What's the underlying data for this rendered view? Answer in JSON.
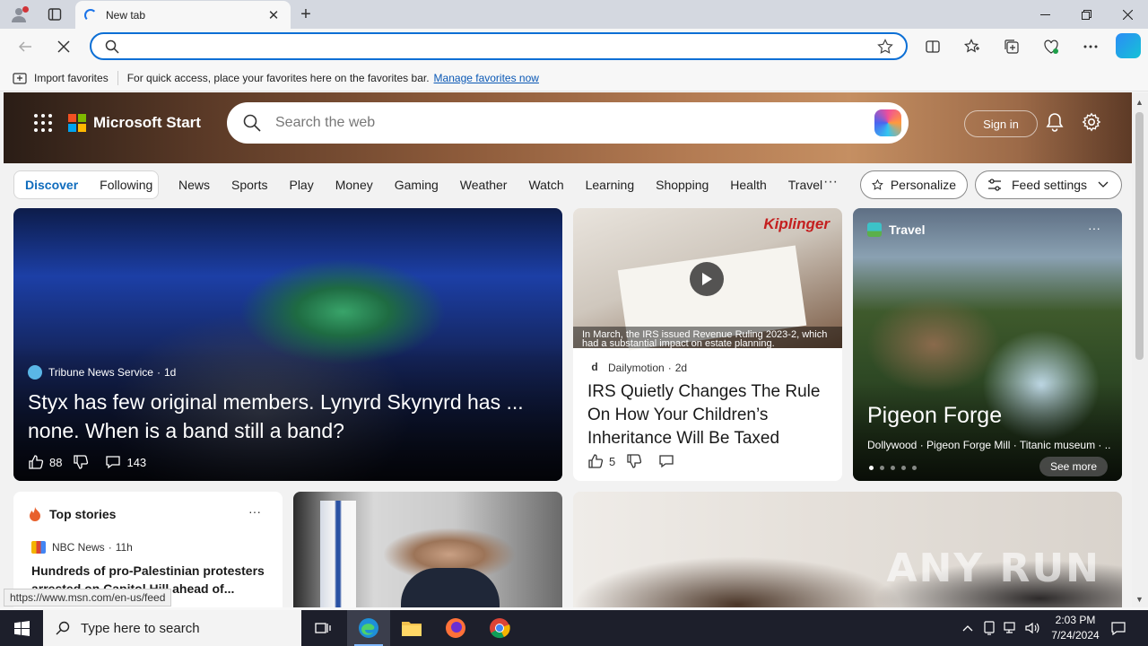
{
  "browser": {
    "tab_title": "New tab",
    "address_value": "",
    "favorites_bar": {
      "import_label": "Import favorites",
      "message": "For quick access, place your favorites here on the favorites bar.",
      "manage_link": "Manage favorites now"
    },
    "status_url": "https://www.msn.com/en-us/feed"
  },
  "msn": {
    "brand": "Microsoft Start",
    "search_placeholder": "Search the web",
    "sign_in": "Sign in",
    "pills": [
      "Discover",
      "Following"
    ],
    "nav": [
      "News",
      "Sports",
      "Play",
      "Money",
      "Gaming",
      "Weather",
      "Watch",
      "Learning",
      "Shopping",
      "Health",
      "Travel"
    ],
    "more": "···",
    "personalize": "Personalize",
    "feed_settings": "Feed settings"
  },
  "cards": {
    "main": {
      "source": "Tribune News Service",
      "age": "1d",
      "headline": "Styx has few original members. Lynyrd Skynyrd has ... none. When is a band still a band?",
      "likes": "88",
      "comments": "143"
    },
    "irs": {
      "brand_overlay": "Kiplinger",
      "caption": "In March, the IRS issued Revenue Ruling 2023-2, which had a substantial impact on estate planning.",
      "source": "Dailymotion",
      "age": "2d",
      "headline": "IRS Quietly Changes The Rule On How Your Children’s Inheritance Will Be Taxed",
      "likes": "5"
    },
    "travel": {
      "category": "Travel",
      "title": "Pigeon Forge",
      "subtitle": "Dollywood · Pigeon Forge Mill · Titanic museum · ...",
      "see_more": "See more"
    },
    "top_stories": {
      "title": "Top stories",
      "source": "NBC News",
      "age": "11h",
      "headline": "Hundreds of pro-Palestinian protesters arrested on Capitol Hill ahead of..."
    },
    "watermark": "ANY RUN"
  },
  "taskbar": {
    "search_placeholder": "Type here to search",
    "time": "2:03 PM",
    "date": "7/24/2024"
  },
  "colors": {
    "accent": "#0f6cbd",
    "address_border": "#0c6fd5",
    "taskbar": "#1d1f2b"
  }
}
